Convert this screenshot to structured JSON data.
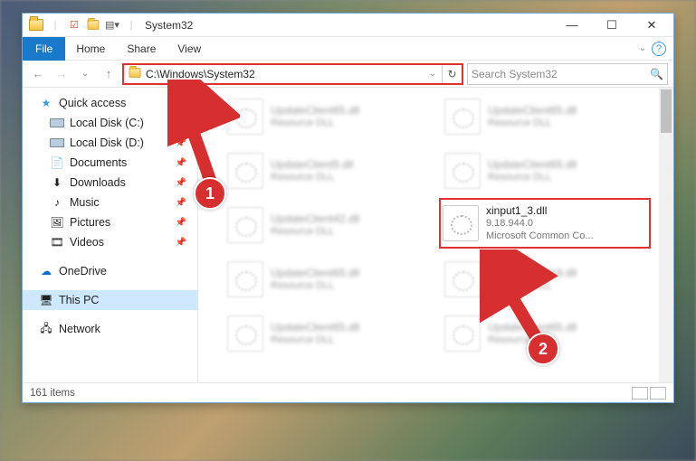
{
  "title": "System32",
  "menubar": {
    "file": "File",
    "home": "Home",
    "share": "Share",
    "view": "View"
  },
  "address": {
    "path": "C:\\Windows\\System32"
  },
  "search": {
    "placeholder": "Search System32"
  },
  "sidebar": {
    "quick": "Quick access",
    "items": [
      {
        "label": "Local Disk (C:)",
        "icon": "drive"
      },
      {
        "label": "Local Disk (D:)",
        "icon": "drive"
      },
      {
        "label": "Documents",
        "icon": "doc"
      },
      {
        "label": "Downloads",
        "icon": "dl"
      },
      {
        "label": "Music",
        "icon": "music"
      },
      {
        "label": "Pictures",
        "icon": "pic"
      },
      {
        "label": "Videos",
        "icon": "vid"
      }
    ],
    "onedrive": "OneDrive",
    "thispc": "This PC",
    "network": "Network"
  },
  "files": {
    "blurred": [
      {
        "name": "UpdateClient65.dll",
        "sub": "Resource DLL"
      },
      {
        "name": "UpdateClient5.dll",
        "sub": "Resource DLL"
      },
      {
        "name": "UpdateClient42.dll",
        "sub": "Resource DLL"
      },
      {
        "name": "UpdateClient65.dll",
        "sub": "Resource DLL"
      },
      {
        "name": "UpdateClient65.dll",
        "sub": "Resource DLL"
      },
      {
        "name": "UpdateClient65.dll",
        "sub": "Resource DLL"
      },
      {
        "name": "UpdateClient65.dll",
        "sub": "Resource DLL"
      },
      {
        "name": "UpdateClient19.dll",
        "sub": "Resource DLL"
      },
      {
        "name": "UpdateClient65.dll",
        "sub": "Resource DLL"
      }
    ],
    "highlighted": {
      "name": "xinput1_3.dll",
      "version": "9.18.944.0",
      "desc": "Microsoft Common Co..."
    }
  },
  "status": {
    "count": "161 items"
  },
  "annotations": {
    "n1": "1",
    "n2": "2"
  }
}
